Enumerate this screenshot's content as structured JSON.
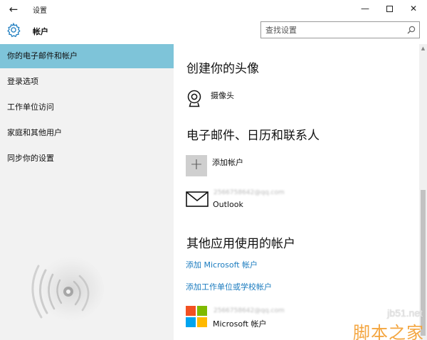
{
  "window": {
    "title": "设置",
    "back_glyph": "←",
    "minimize_glyph": "—",
    "close_glyph": "✕"
  },
  "header": {
    "title": "帐户",
    "icon": "gear-icon",
    "search_placeholder": "查找设置"
  },
  "sidebar": {
    "items": [
      {
        "label": "你的电子邮件和帐户",
        "active": true
      },
      {
        "label": "登录选项",
        "active": false
      },
      {
        "label": "工作单位访问",
        "active": false
      },
      {
        "label": "家庭和其他用户",
        "active": false
      },
      {
        "label": "同步你的设置",
        "active": false
      }
    ]
  },
  "main": {
    "avatar_section": {
      "title": "创建你的头像",
      "camera_label": "摄像头"
    },
    "email_section": {
      "title": "电子邮件、日历和联系人",
      "add_account_label": "添加帐户",
      "plus_glyph": "+",
      "outlook_account": {
        "email": "2566758642@qq.com",
        "provider": "Outlook"
      }
    },
    "other_apps_section": {
      "title": "其他应用使用的帐户",
      "add_microsoft_link": "添加 Microsoft 帐户",
      "add_work_link": "添加工作单位或学校帐户",
      "microsoft_account": {
        "email": "2566758642@qq.com",
        "provider": "Microsoft 帐户"
      }
    }
  },
  "watermark": {
    "site": "jb51.net",
    "name": "脚本之家"
  },
  "colors": {
    "accent_link": "#1a7bbf",
    "sidebar_active": "#7ec4d9",
    "sidebar_bg": "#f2f2f2",
    "watermark_orange": "#f4a640"
  }
}
